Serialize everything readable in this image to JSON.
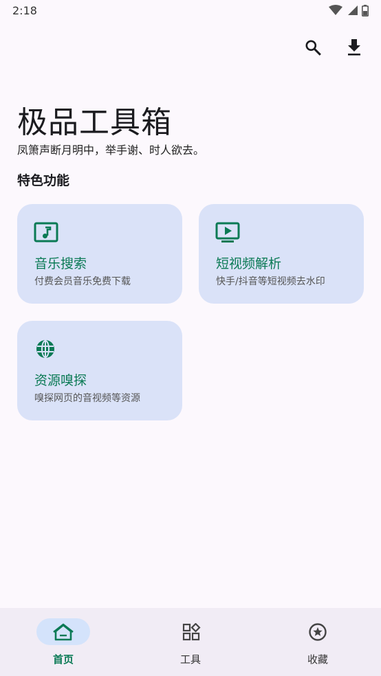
{
  "status_bar": {
    "time": "2:18"
  },
  "header": {
    "title": "极品工具箱",
    "subtitle": "凤箫声断月明中，举手谢、时人欲去。"
  },
  "section": {
    "title": "特色功能"
  },
  "cards": [
    {
      "title": "音乐搜索",
      "desc": "付费会员音乐免费下载",
      "icon": "music-note-icon"
    },
    {
      "title": "短视频解析",
      "desc": "快手/抖音等短视频去水印",
      "icon": "video-play-icon"
    },
    {
      "title": "资源嗅探",
      "desc": "嗅探网页的音视频等资源",
      "icon": "globe-icon"
    }
  ],
  "bottom_nav": [
    {
      "label": "首页",
      "icon": "home-icon",
      "active": true
    },
    {
      "label": "工具",
      "icon": "widgets-icon",
      "active": false
    },
    {
      "label": "收藏",
      "icon": "star-circle-icon",
      "active": false
    }
  ],
  "colors": {
    "accent": "#0b7a55",
    "card_bg": "#dae2f8",
    "background": "#fcf8fd",
    "nav_bg": "#f1ecf5"
  }
}
